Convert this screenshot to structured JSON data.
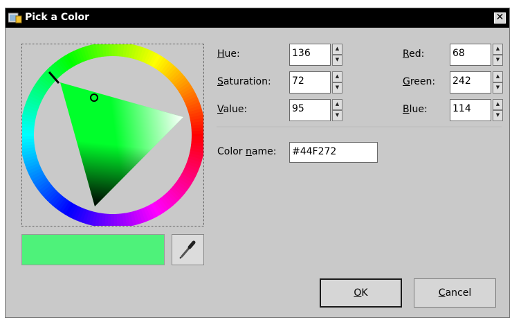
{
  "window": {
    "title": "Pick a Color",
    "close_label": "✕"
  },
  "fields": {
    "hue": {
      "pre": "",
      "mn": "H",
      "post": "ue:",
      "value": "136"
    },
    "saturation": {
      "pre": "",
      "mn": "S",
      "post": "aturation:",
      "value": "72"
    },
    "value": {
      "pre": "",
      "mn": "V",
      "post": "alue:",
      "value": "95"
    },
    "red": {
      "pre": "",
      "mn": "R",
      "post": "ed:",
      "value": "68"
    },
    "green": {
      "pre": "",
      "mn": "G",
      "post": "reen:",
      "value": "242"
    },
    "blue": {
      "pre": "",
      "mn": "B",
      "post": "lue:",
      "value": "114"
    },
    "color_name": {
      "pre": "Color ",
      "mn": "n",
      "post": "ame:",
      "value": "#44F272"
    }
  },
  "buttons": {
    "ok": {
      "pre": "",
      "mn": "O",
      "post": "K"
    },
    "cancel": {
      "pre": "",
      "mn": "C",
      "post": "ancel"
    }
  },
  "colors": {
    "current": "#4ef27a",
    "hue_color": "#00ff2b"
  },
  "icons": {
    "app": "color-picker-app-icon",
    "eyedropper": "eyedropper-icon",
    "close": "close-icon"
  }
}
